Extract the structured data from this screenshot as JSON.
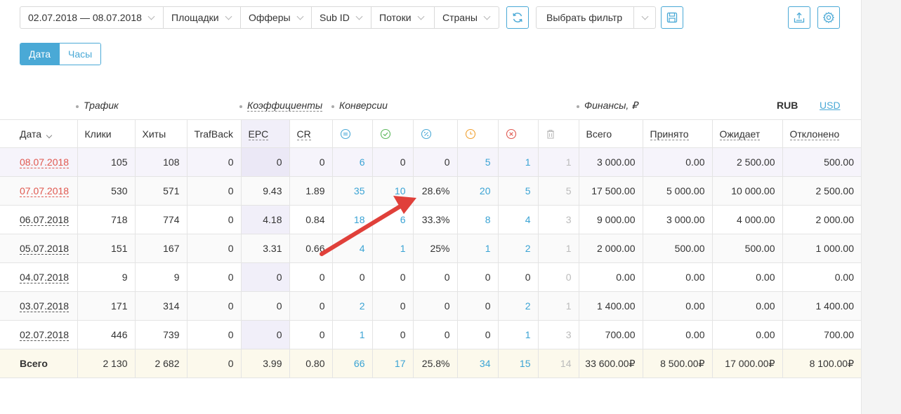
{
  "toolbar": {
    "date_range": "02.07.2018 — 08.07.2018",
    "filters": [
      "Площадки",
      "Офферы",
      "Sub ID",
      "Потоки",
      "Страны"
    ],
    "refresh_icon": "refresh-icon",
    "select_filter_label": "Выбрать фильтр",
    "save_icon": "save-icon",
    "export_icon": "export-icon",
    "settings_icon": "gear-icon"
  },
  "toggle": {
    "date_label": "Дата",
    "hours_label": "Часы",
    "active": "date"
  },
  "groups": {
    "traffic": "Трафик",
    "coefficients": "Коэффициенты",
    "conversions": "Конверсии",
    "finances": "Финансы, ₽",
    "currency_rub": "RUB",
    "currency_usd": "USD"
  },
  "columns": {
    "date": "Дата",
    "clicks": "Клики",
    "hits": "Хиты",
    "trafback": "TrafBack",
    "epc": "EPC",
    "cr": "CR",
    "total": "Всего",
    "accepted": "Принято",
    "pending": "Ожидает",
    "rejected": "Отклонено"
  },
  "rows": [
    {
      "date": "08.07.2018",
      "clicks": "105",
      "hits": "108",
      "trafback": "0",
      "epc": "0",
      "cr": "0",
      "c_all": "6",
      "c_ok": "0",
      "c_pct": "0",
      "c_wait": "5",
      "c_rej": "1",
      "c_trash": "1",
      "total": "3 000.00",
      "accepted": "0.00",
      "pending": "2 500.00",
      "rejected": "500.00"
    },
    {
      "date": "07.07.2018",
      "clicks": "530",
      "hits": "571",
      "trafback": "0",
      "epc": "9.43",
      "cr": "1.89",
      "c_all": "35",
      "c_ok": "10",
      "c_pct": "28.6%",
      "c_wait": "20",
      "c_rej": "5",
      "c_trash": "5",
      "total": "17 500.00",
      "accepted": "5 000.00",
      "pending": "10 000.00",
      "rejected": "2 500.00"
    },
    {
      "date": "06.07.2018",
      "clicks": "718",
      "hits": "774",
      "trafback": "0",
      "epc": "4.18",
      "cr": "0.84",
      "c_all": "18",
      "c_ok": "6",
      "c_pct": "33.3%",
      "c_wait": "8",
      "c_rej": "4",
      "c_trash": "3",
      "total": "9 000.00",
      "accepted": "3 000.00",
      "pending": "4 000.00",
      "rejected": "2 000.00"
    },
    {
      "date": "05.07.2018",
      "clicks": "151",
      "hits": "167",
      "trafback": "0",
      "epc": "3.31",
      "cr": "0.66",
      "c_all": "4",
      "c_ok": "1",
      "c_pct": "25%",
      "c_wait": "1",
      "c_rej": "2",
      "c_trash": "1",
      "total": "2 000.00",
      "accepted": "500.00",
      "pending": "500.00",
      "rejected": "1 000.00"
    },
    {
      "date": "04.07.2018",
      "clicks": "9",
      "hits": "9",
      "trafback": "0",
      "epc": "0",
      "cr": "0",
      "c_all": "0",
      "c_ok": "0",
      "c_pct": "0",
      "c_wait": "0",
      "c_rej": "0",
      "c_trash": "0",
      "total": "0.00",
      "accepted": "0.00",
      "pending": "0.00",
      "rejected": "0.00"
    },
    {
      "date": "03.07.2018",
      "clicks": "171",
      "hits": "314",
      "trafback": "0",
      "epc": "0",
      "cr": "0",
      "c_all": "2",
      "c_ok": "0",
      "c_pct": "0",
      "c_wait": "0",
      "c_rej": "2",
      "c_trash": "1",
      "total": "1 400.00",
      "accepted": "0.00",
      "pending": "0.00",
      "rejected": "1 400.00"
    },
    {
      "date": "02.07.2018",
      "clicks": "446",
      "hits": "739",
      "trafback": "0",
      "epc": "0",
      "cr": "0",
      "c_all": "1",
      "c_ok": "0",
      "c_pct": "0",
      "c_wait": "0",
      "c_rej": "1",
      "c_trash": "3",
      "total": "700.00",
      "accepted": "0.00",
      "pending": "0.00",
      "rejected": "700.00"
    }
  ],
  "totals": {
    "label": "Всего",
    "clicks": "2 130",
    "hits": "2 682",
    "trafback": "0",
    "epc": "3.99",
    "cr": "0.80",
    "c_all": "66",
    "c_ok": "17",
    "c_pct": "25.8%",
    "c_wait": "34",
    "c_rej": "15",
    "c_trash": "14",
    "total": "33 600.00₽",
    "accepted": "8 500.00₽",
    "pending": "17 000.00₽",
    "rejected": "8 100.00₽"
  },
  "colors": {
    "accent": "#4aa9d6",
    "link": "#3aa3d4",
    "today_date": "#e0584f",
    "arrow": "#e0403a",
    "ok": "#5cb85c",
    "wait": "#f0a030",
    "reject": "#e0584f"
  }
}
